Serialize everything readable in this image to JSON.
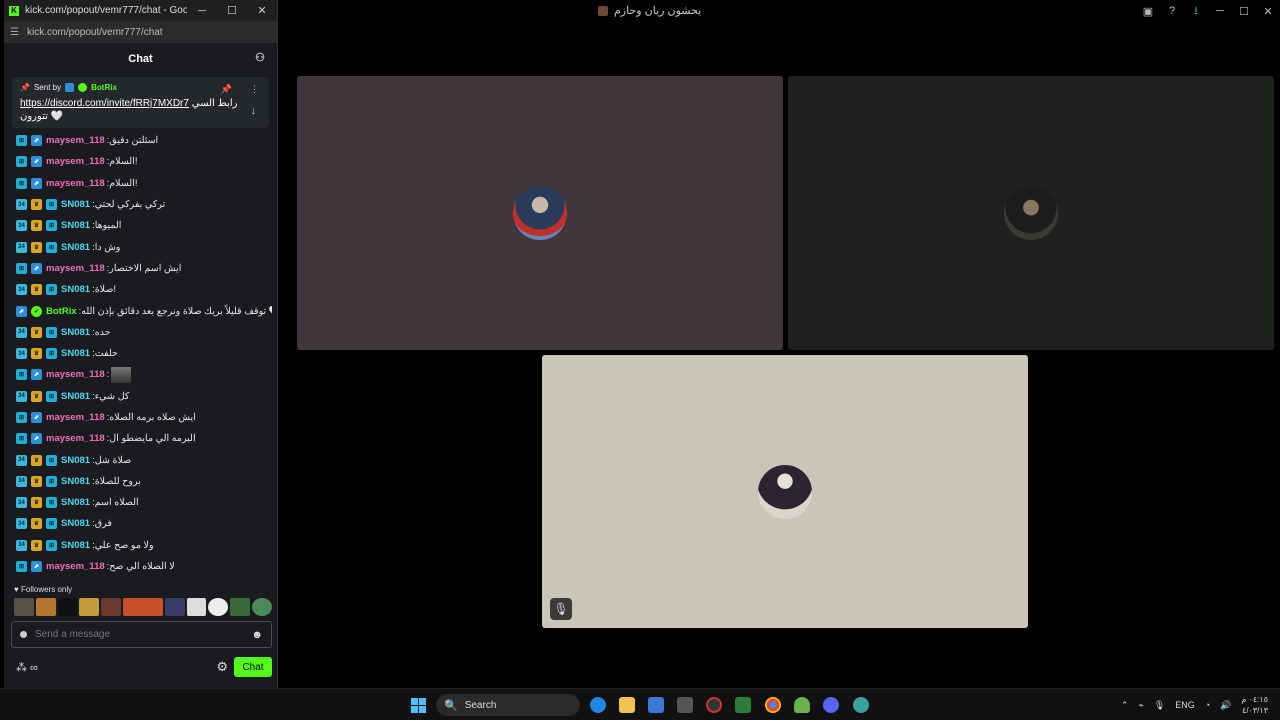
{
  "bg_window": {
    "title": "يحشون ريان وحازم",
    "icons": [
      "picture-in-picture-icon",
      "help-icon",
      "download-icon",
      "minimize-icon",
      "maximize-icon",
      "close-icon"
    ],
    "minimize": "─",
    "maximize": "☐",
    "close": "✕",
    "pip": "▣",
    "help": "?",
    "download": "⭳"
  },
  "popout": {
    "window_title": "kick.com/popout/vemr777/chat - Google Ch...",
    "url": "kick.com/popout/vemr777/chat",
    "chat_header": "Chat",
    "pinned": {
      "sent_by_label": "Sent by",
      "sender": "BotRix",
      "link": "https://discord.com/invite/fRRj7MXDr7",
      "text_after": "رابط السي",
      "text_line2": "تتورون 🤍"
    },
    "messages": [
      {
        "user": "maysem_118",
        "color": "pink",
        "text": "اسئلتن دقيق",
        "badges": [
          "sub",
          "blue"
        ]
      },
      {
        "user": "maysem_118",
        "color": "pink",
        "text": "السلام!",
        "badges": [
          "sub",
          "blue"
        ]
      },
      {
        "user": "maysem_118",
        "color": "pink",
        "text": "السلام!",
        "badges": [
          "sub",
          "blue"
        ]
      },
      {
        "user": "SN081",
        "color": "cyan",
        "text": "تركي بفركي لحتي",
        "badges": [
          "num",
          "crown",
          "sub"
        ]
      },
      {
        "user": "SN081",
        "color": "cyan",
        "text": "الميوها",
        "badges": [
          "num",
          "crown",
          "sub"
        ]
      },
      {
        "user": "SN081",
        "color": "cyan",
        "text": "وش دا",
        "badges": [
          "num",
          "crown",
          "sub"
        ]
      },
      {
        "user": "maysem_118",
        "color": "pink",
        "text": "ايش اسم الاختصار",
        "badges": [
          "sub",
          "blue"
        ]
      },
      {
        "user": "SN081",
        "color": "cyan",
        "text": "صلاة!",
        "badges": [
          "num",
          "crown",
          "sub"
        ]
      },
      {
        "user": "BotRix",
        "color": "green",
        "text": "توقف قليلاً بريك صلاة ونرجع بعد دقائق بإذن الله 🤍",
        "badges": [
          "blue",
          "ok"
        ]
      },
      {
        "user": "SN081",
        "color": "cyan",
        "text": "حده",
        "badges": [
          "num",
          "crown",
          "sub"
        ]
      },
      {
        "user": "SN081",
        "color": "cyan",
        "text": "حلفت",
        "badges": [
          "num",
          "crown",
          "sub"
        ]
      },
      {
        "user": "maysem_118",
        "color": "pink",
        "text": "",
        "badges": [
          "sub",
          "blue"
        ],
        "emote": true
      },
      {
        "user": "SN081",
        "color": "cyan",
        "text": "كل شيء",
        "badges": [
          "num",
          "crown",
          "sub"
        ]
      },
      {
        "user": "maysem_118",
        "color": "pink",
        "text": "ايش صلاه برمه الصلاه",
        "badges": [
          "sub",
          "blue"
        ]
      },
      {
        "user": "maysem_118",
        "color": "pink",
        "text": "البرمه الي مايضطو ال",
        "badges": [
          "sub",
          "blue"
        ]
      },
      {
        "user": "SN081",
        "color": "cyan",
        "text": "صلاة شل",
        "badges": [
          "num",
          "crown",
          "sub"
        ]
      },
      {
        "user": "SN081",
        "color": "cyan",
        "text": "بروح للصلاة",
        "badges": [
          "num",
          "crown",
          "sub"
        ]
      },
      {
        "user": "SN081",
        "color": "cyan",
        "text": "الصلاه اسم",
        "badges": [
          "num",
          "crown",
          "sub"
        ]
      },
      {
        "user": "SN081",
        "color": "cyan",
        "text": "فرق",
        "badges": [
          "num",
          "crown",
          "sub"
        ]
      },
      {
        "user": "SN081",
        "color": "cyan",
        "text": "ولا مو صح علي",
        "badges": [
          "num",
          "crown",
          "sub"
        ]
      },
      {
        "user": "maysem_118",
        "color": "pink",
        "text": "لا الصلاه الي صح",
        "badges": [
          "sub",
          "blue"
        ]
      }
    ],
    "followers_only": "Followers only",
    "send_placeholder": "Send a message",
    "chat_button": "Chat"
  },
  "taskbar": {
    "search_label": "Search",
    "language": "ENG",
    "time": "٠٤:١٥ م",
    "date": "٤/٠٣/١٣"
  },
  "colors": {
    "kick_green": "#53fc18",
    "pink_user": "#f06ebd",
    "cyan_user": "#48d8f0"
  }
}
